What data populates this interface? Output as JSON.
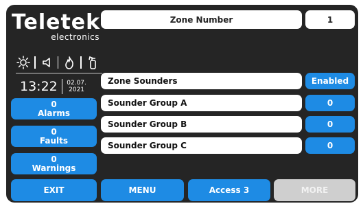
{
  "brand": {
    "name": "Teletek",
    "sub": "electronics"
  },
  "status_icons": [
    "sun-icon",
    "speaker-icon",
    "fire-icon",
    "extinguisher-icon"
  ],
  "clock": {
    "time": "13:22",
    "date_line1": "02.07.",
    "date_line2": "2021"
  },
  "side_buttons": [
    {
      "count": "0",
      "label": "Alarms"
    },
    {
      "count": "0",
      "label": "Faults"
    },
    {
      "count": "0",
      "label": "Warnings"
    }
  ],
  "header": {
    "title": "Zone Number",
    "value": "1"
  },
  "rows": [
    {
      "label": "Zone Sounders",
      "value": "Enabled"
    },
    {
      "label": "Sounder Group A",
      "value": "0"
    },
    {
      "label": "Sounder Group B",
      "value": "0"
    },
    {
      "label": "Sounder Group C",
      "value": "0"
    }
  ],
  "bottom": {
    "exit": "EXIT",
    "menu": "MENU",
    "access": "Access 3",
    "more": "MORE"
  },
  "colors": {
    "background": "#252525",
    "accent": "#1e8be4",
    "disabled": "#cfcfcf"
  }
}
